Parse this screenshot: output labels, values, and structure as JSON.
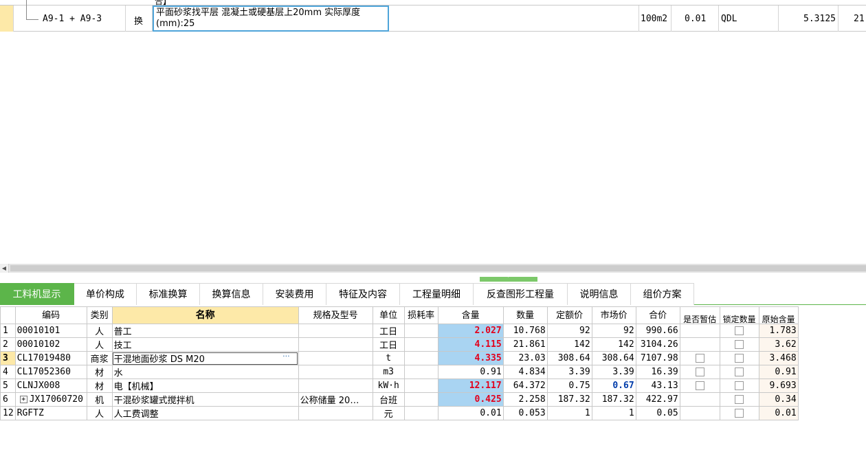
{
  "top_grid": {
    "prev_row_fragment": "合】",
    "row": {
      "code": "A9-1 + A9-3",
      "type": "换",
      "name": "平面砂浆找平层 混凝土或硬基层上20mm  实际厚度(mm):25",
      "unit": "100m2",
      "quantity": "0.01",
      "expression": "QDL",
      "value": "5.3125",
      "value_cut": "21"
    }
  },
  "tabs": [
    {
      "label": "工料机显示",
      "active": true
    },
    {
      "label": "单价构成",
      "active": false
    },
    {
      "label": "标准换算",
      "active": false
    },
    {
      "label": "换算信息",
      "active": false
    },
    {
      "label": "安装费用",
      "active": false
    },
    {
      "label": "特征及内容",
      "active": false
    },
    {
      "label": "工程量明细",
      "active": false
    },
    {
      "label": "反查图形工程量",
      "active": false
    },
    {
      "label": "说明信息",
      "active": false
    },
    {
      "label": "组价方案",
      "active": false
    }
  ],
  "columns": {
    "code": "编码",
    "category": "类别",
    "name": "名称",
    "spec": "规格及型号",
    "unit": "单位",
    "loss": "损耗率",
    "content": "含量",
    "amount": "数量",
    "quota_price": "定额价",
    "market_price": "市场价",
    "total": "合价",
    "is_estimate": "是否暂估",
    "lock_amount": "锁定数量",
    "orig_content": "原始含量"
  },
  "rows": [
    {
      "no": "1",
      "code": "00010101",
      "category": "人",
      "name": "普工",
      "spec": "",
      "unit": "工日",
      "loss": "",
      "content": "2.027",
      "content_hl": true,
      "amount": "10.768",
      "quota_price": "92",
      "market_price": "92",
      "market_blue": false,
      "total": "990.66",
      "has_estimate_cb": false,
      "orig_content": "1.783"
    },
    {
      "no": "2",
      "code": "00010102",
      "category": "人",
      "name": "技工",
      "spec": "",
      "unit": "工日",
      "loss": "",
      "content": "4.115",
      "content_hl": true,
      "amount": "21.861",
      "quota_price": "142",
      "market_price": "142",
      "market_blue": false,
      "total": "3104.26",
      "has_estimate_cb": false,
      "orig_content": "3.62"
    },
    {
      "no": "3",
      "code": "CL17019480",
      "category": "商浆",
      "name": "干混地面砂浆 DS M20",
      "spec": "",
      "unit": "t",
      "loss": "",
      "content": "4.335",
      "content_hl": true,
      "amount": "23.03",
      "quota_price": "308.64",
      "market_price": "308.64",
      "market_blue": false,
      "total": "7107.98",
      "has_estimate_cb": true,
      "orig_content": "3.468",
      "current": true,
      "name_more": "···"
    },
    {
      "no": "4",
      "code": "CL17052360",
      "category": "材",
      "name": "水",
      "spec": "",
      "unit": "m3",
      "loss": "",
      "content": "0.91",
      "content_hl": false,
      "amount": "4.834",
      "quota_price": "3.39",
      "market_price": "3.39",
      "market_blue": false,
      "total": "16.39",
      "has_estimate_cb": true,
      "orig_content": "0.91"
    },
    {
      "no": "5",
      "code": "CLNJX008",
      "category": "材",
      "name": "电【机械】",
      "spec": "",
      "unit": "kW·h",
      "loss": "",
      "content": "12.117",
      "content_hl": true,
      "amount": "64.372",
      "quota_price": "0.75",
      "market_price": "0.67",
      "market_blue": true,
      "total": "43.13",
      "has_estimate_cb": true,
      "orig_content": "9.693"
    },
    {
      "no": "6",
      "code": "JX17060720",
      "category": "机",
      "name": "干混砂浆罐式搅拌机",
      "spec": "公称储量 20…",
      "unit": "台班",
      "loss": "",
      "content": "0.425",
      "content_hl": true,
      "amount": "2.258",
      "quota_price": "187.32",
      "market_price": "187.32",
      "market_blue": false,
      "total": "422.97",
      "has_estimate_cb": false,
      "orig_content": "0.34",
      "expandable": true,
      "expand_glyph": "+"
    },
    {
      "no": "12",
      "code": "RGFTZ",
      "category": "人",
      "name": "人工费调整",
      "spec": "",
      "unit": "元",
      "loss": "",
      "content": "0.01",
      "content_hl": false,
      "amount": "0.053",
      "quota_price": "1",
      "market_price": "1",
      "market_blue": false,
      "total": "0.05",
      "has_estimate_cb": false,
      "orig_content": "0.01"
    }
  ]
}
